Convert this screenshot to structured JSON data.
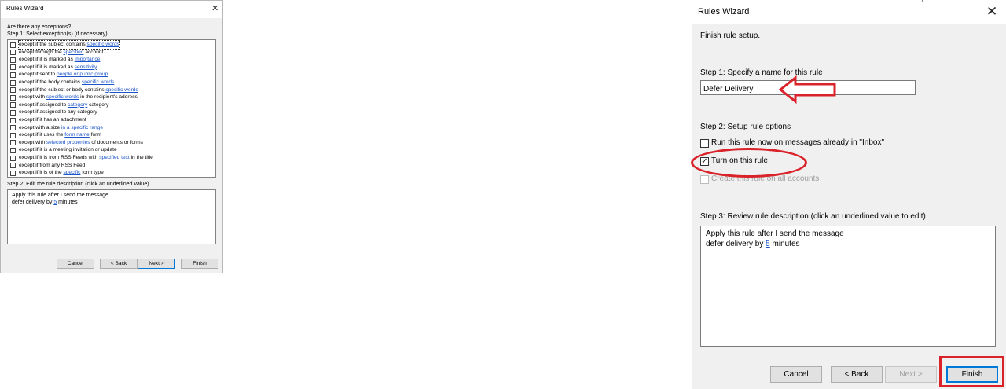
{
  "left_dialog": {
    "title": "Rules Wizard",
    "question": "Are there any exceptions?",
    "step1_label": "Step 1: Select exception(s) (if necessary)",
    "exceptions": [
      {
        "pre": "except if the subject contains ",
        "link": "specific words",
        "post": ""
      },
      {
        "pre": "except through the ",
        "link": "specified",
        "post": " account"
      },
      {
        "pre": "except if it is marked as ",
        "link": "importance",
        "post": ""
      },
      {
        "pre": "except if it is marked as ",
        "link": "sensitivity",
        "post": ""
      },
      {
        "pre": "except if sent to ",
        "link": "people or public group",
        "post": ""
      },
      {
        "pre": "except if the body contains ",
        "link": "specific words",
        "post": ""
      },
      {
        "pre": "except if the subject or body contains ",
        "link": "specific words",
        "post": ""
      },
      {
        "pre": "except with ",
        "link": "specific words",
        "post": " in the recipient's address"
      },
      {
        "pre": "except if assigned to ",
        "link": "category",
        "post": " category"
      },
      {
        "pre": "except if assigned to any category",
        "link": "",
        "post": ""
      },
      {
        "pre": "except if it has an attachment",
        "link": "",
        "post": ""
      },
      {
        "pre": "except with a size ",
        "link": "in a specific range",
        "post": ""
      },
      {
        "pre": "except if it uses the ",
        "link": "form name",
        "post": " form"
      },
      {
        "pre": "except with ",
        "link": "selected properties",
        "post": " of documents or forms"
      },
      {
        "pre": "except if it is a meeting invitation or update",
        "link": "",
        "post": ""
      },
      {
        "pre": "except if it is from RSS Feeds with ",
        "link": "specified text",
        "post": " in the title"
      },
      {
        "pre": "except if from any RSS Feed",
        "link": "",
        "post": ""
      },
      {
        "pre": "except if it is of the ",
        "link": "specific",
        "post": " form type"
      }
    ],
    "step2_label": "Step 2: Edit the rule description (click an underlined value)",
    "description": {
      "line1": "Apply this rule after I send the message",
      "line2_pre": "defer delivery by ",
      "line2_link": "5",
      "line2_post": " minutes"
    },
    "buttons": {
      "cancel": "Cancel",
      "back": "< Back",
      "next": "Next >",
      "finish": "Finish"
    }
  },
  "right_dialog": {
    "title": "Rules Wizard",
    "heading": "Finish rule setup.",
    "step1_label": "Step 1: Specify a name for this rule",
    "rule_name": "Defer Delivery",
    "step2_label": "Step 2: Setup rule options",
    "options": [
      {
        "label": "Run this rule now on messages already in \"Inbox\"",
        "checked": false,
        "enabled": true
      },
      {
        "label": "Turn on this rule",
        "checked": true,
        "enabled": true
      },
      {
        "label": "Create this rule on all accounts",
        "checked": false,
        "enabled": false
      }
    ],
    "step3_label": "Step 3: Review rule description (click an underlined value to edit)",
    "description": {
      "line1": "Apply this rule after I send the message",
      "line2_pre": "defer delivery by ",
      "line2_link": "5",
      "line2_post": " minutes"
    },
    "buttons": {
      "cancel": "Cancel",
      "back": "< Back",
      "next": "Next >",
      "finish": "Finish"
    }
  },
  "annotation_color": "#d9222a",
  "icons": {
    "close": "close-icon",
    "check": "checkmark-icon",
    "arrow": "left-arrow-annotation-icon"
  }
}
